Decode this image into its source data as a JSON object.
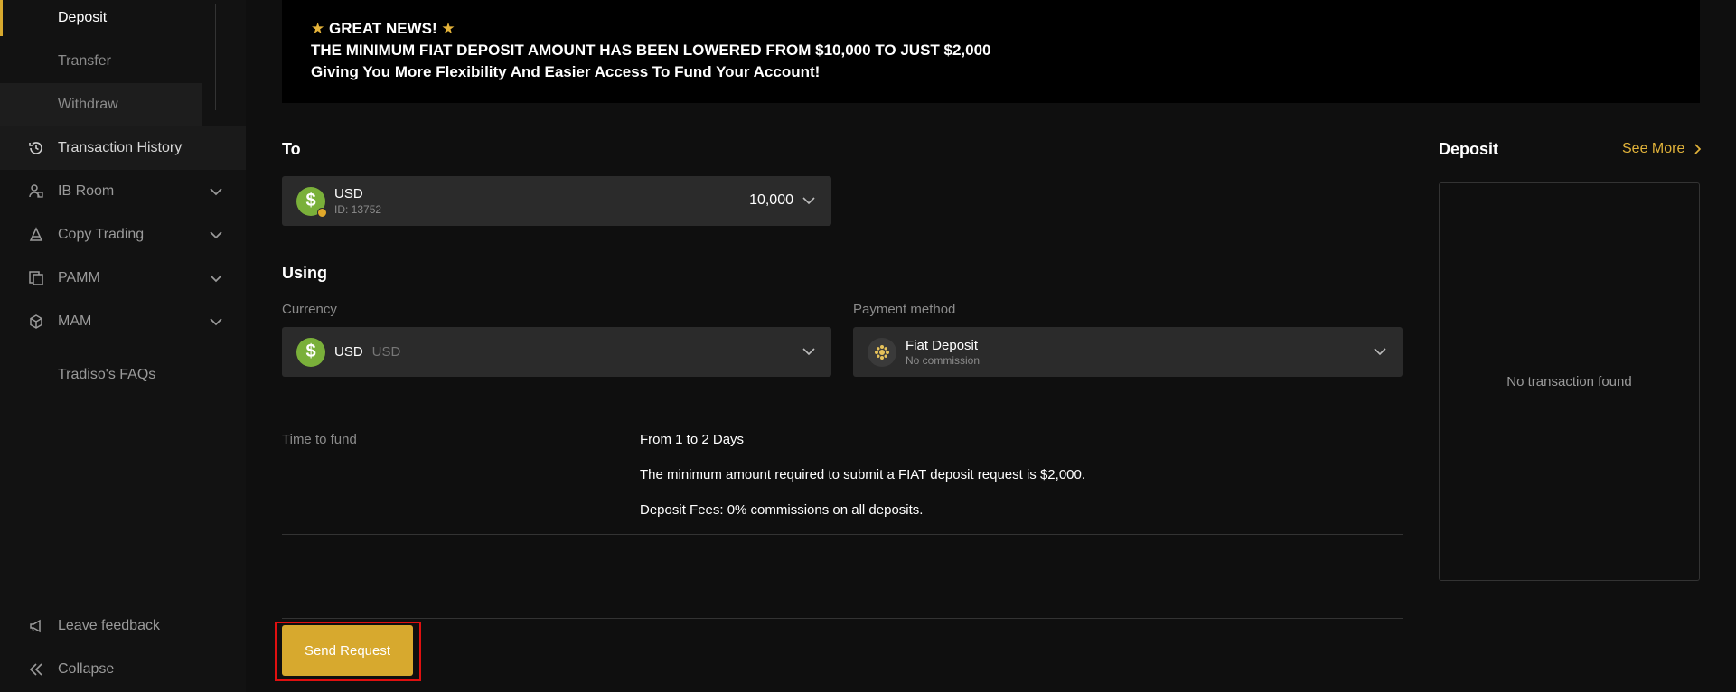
{
  "sidebar": {
    "sub_items": [
      "Deposit",
      "Transfer",
      "Withdraw"
    ],
    "items": [
      {
        "label": "Transaction History",
        "icon": "history-icon",
        "has_chevron": false
      },
      {
        "label": "IB Room",
        "icon": "ib-room-icon",
        "has_chevron": true
      },
      {
        "label": "Copy Trading",
        "icon": "copy-trading-icon",
        "has_chevron": true
      },
      {
        "label": "PAMM",
        "icon": "pamm-icon",
        "has_chevron": true
      },
      {
        "label": "MAM",
        "icon": "mam-icon",
        "has_chevron": true
      },
      {
        "label": "Tradiso's FAQs",
        "icon": "",
        "has_chevron": false
      }
    ],
    "feedback_label": "Leave feedback",
    "collapse_label": "Collapse"
  },
  "banner": {
    "line1": "GREAT NEWS!",
    "line2": "THE MINIMUM FIAT DEPOSIT AMOUNT HAS BEEN LOWERED FROM $10,000 TO JUST $2,000",
    "line3": "Giving You More Flexibility And Easier Access To Fund Your Account!"
  },
  "to_section": {
    "title": "To",
    "account_currency": "USD",
    "account_id": "ID: 13752",
    "amount": "10,000"
  },
  "using_section": {
    "title": "Using",
    "currency_label": "Currency",
    "currency_value": "USD",
    "currency_code": "USD",
    "payment_label": "Payment method",
    "payment_name": "Fiat Deposit",
    "payment_sub": "No commission"
  },
  "info": {
    "time_label": "Time to fund",
    "time_value": "From 1 to 2 Days",
    "min_note": "The minimum amount required to submit a FIAT deposit request is $2,000.",
    "fee_note": "Deposit Fees: 0% commissions on all deposits."
  },
  "send_button": "Send Request",
  "right_panel": {
    "title": "Deposit",
    "see_more": "See More",
    "empty": "No transaction found"
  },
  "colors": {
    "accent": "#d7a92e",
    "coin_green": "#7ab03a"
  }
}
